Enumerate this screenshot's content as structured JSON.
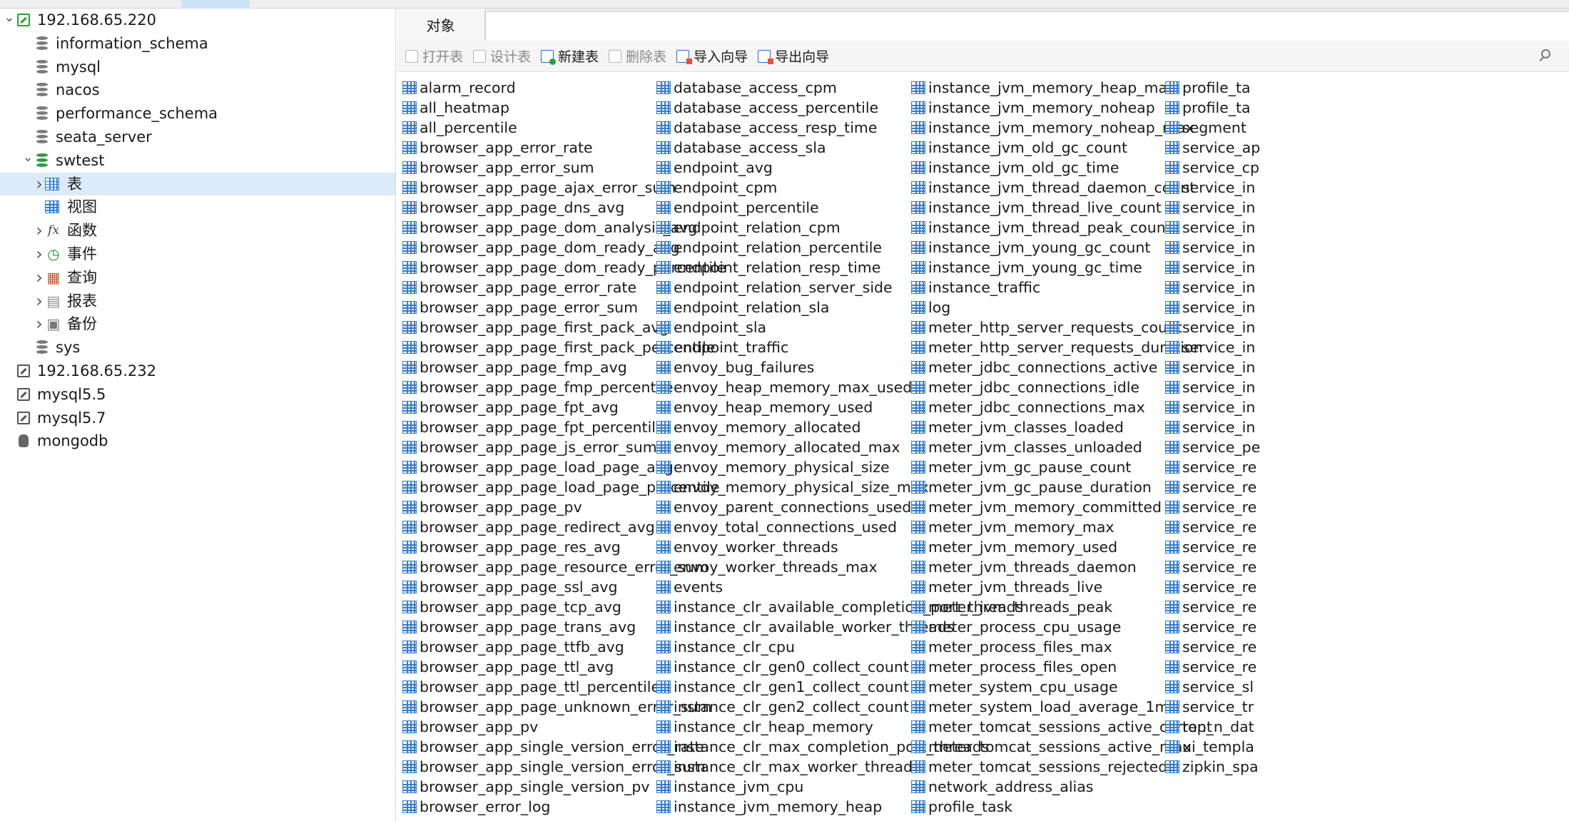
{
  "sidebar": {
    "tree": [
      {
        "label": "192.168.65.220",
        "icon": "connection-green-icon",
        "indent": 0,
        "arrow": "down"
      },
      {
        "label": "information_schema",
        "icon": "database-icon",
        "indent": 1,
        "arrow": ""
      },
      {
        "label": "mysql",
        "icon": "database-icon",
        "indent": 1,
        "arrow": ""
      },
      {
        "label": "nacos",
        "icon": "database-icon",
        "indent": 1,
        "arrow": ""
      },
      {
        "label": "performance_schema",
        "icon": "database-icon",
        "indent": 1,
        "arrow": ""
      },
      {
        "label": "seata_server",
        "icon": "database-icon",
        "indent": 1,
        "arrow": ""
      },
      {
        "label": "swtest",
        "icon": "database-green-icon",
        "indent": 1,
        "arrow": "down"
      },
      {
        "label": "表",
        "icon": "table-icon",
        "indent": 2,
        "arrow": "right",
        "selected": true
      },
      {
        "label": "视图",
        "icon": "view-icon",
        "indent": 2,
        "arrow": ""
      },
      {
        "label": "函数",
        "icon": "function-icon",
        "indent": 2,
        "arrow": "right"
      },
      {
        "label": "事件",
        "icon": "event-icon",
        "indent": 2,
        "arrow": "right"
      },
      {
        "label": "查询",
        "icon": "query-icon",
        "indent": 2,
        "arrow": "right"
      },
      {
        "label": "报表",
        "icon": "report-icon",
        "indent": 2,
        "arrow": "right"
      },
      {
        "label": "备份",
        "icon": "backup-icon",
        "indent": 2,
        "arrow": "right"
      },
      {
        "label": "sys",
        "icon": "database-icon",
        "indent": 1,
        "arrow": ""
      },
      {
        "label": "192.168.65.232",
        "icon": "connection-icon",
        "indent": 0,
        "arrow": ""
      },
      {
        "label": "mysql5.5",
        "icon": "connection-icon",
        "indent": 0,
        "arrow": ""
      },
      {
        "label": "mysql5.7",
        "icon": "connection-icon",
        "indent": 0,
        "arrow": ""
      },
      {
        "label": "mongodb",
        "icon": "mongodb-icon",
        "indent": 0,
        "arrow": ""
      }
    ]
  },
  "tabs": {
    "objects": "对象"
  },
  "toolbar": {
    "open_table": "打开表",
    "design_table": "设计表",
    "new_table": "新建表",
    "delete_table": "删除表",
    "import_wizard": "导入向导",
    "export_wizard": "导出向导"
  },
  "tables": {
    "col1": [
      "alarm_record",
      "all_heatmap",
      "all_percentile",
      "browser_app_error_rate",
      "browser_app_error_sum",
      "browser_app_page_ajax_error_sum",
      "browser_app_page_dns_avg",
      "browser_app_page_dom_analysis_avg",
      "browser_app_page_dom_ready_avg",
      "browser_app_page_dom_ready_percentile",
      "browser_app_page_error_rate",
      "browser_app_page_error_sum",
      "browser_app_page_first_pack_avg",
      "browser_app_page_first_pack_percentile",
      "browser_app_page_fmp_avg",
      "browser_app_page_fmp_percentile",
      "browser_app_page_fpt_avg",
      "browser_app_page_fpt_percentile",
      "browser_app_page_js_error_sum",
      "browser_app_page_load_page_avg",
      "browser_app_page_load_page_percentile",
      "browser_app_page_pv",
      "browser_app_page_redirect_avg",
      "browser_app_page_res_avg",
      "browser_app_page_resource_error_sum",
      "browser_app_page_ssl_avg",
      "browser_app_page_tcp_avg",
      "browser_app_page_trans_avg",
      "browser_app_page_ttfb_avg",
      "browser_app_page_ttl_avg",
      "browser_app_page_ttl_percentile",
      "browser_app_page_unknown_error_sum",
      "browser_app_pv",
      "browser_app_single_version_error_rate",
      "browser_app_single_version_error_sum",
      "browser_app_single_version_pv",
      "browser_error_log"
    ],
    "col2": [
      "database_access_cpm",
      "database_access_percentile",
      "database_access_resp_time",
      "database_access_sla",
      "endpoint_avg",
      "endpoint_cpm",
      "endpoint_percentile",
      "endpoint_relation_cpm",
      "endpoint_relation_percentile",
      "endpoint_relation_resp_time",
      "endpoint_relation_server_side",
      "endpoint_relation_sla",
      "endpoint_sla",
      "endpoint_traffic",
      "envoy_bug_failures",
      "envoy_heap_memory_max_used",
      "envoy_heap_memory_used",
      "envoy_memory_allocated",
      "envoy_memory_allocated_max",
      "envoy_memory_physical_size",
      "envoy_memory_physical_size_max",
      "envoy_parent_connections_used",
      "envoy_total_connections_used",
      "envoy_worker_threads",
      "envoy_worker_threads_max",
      "events",
      "instance_clr_available_completion_port_threads",
      "instance_clr_available_worker_threads",
      "instance_clr_cpu",
      "instance_clr_gen0_collect_count",
      "instance_clr_gen1_collect_count",
      "instance_clr_gen2_collect_count",
      "instance_clr_heap_memory",
      "instance_clr_max_completion_port_threads",
      "instance_clr_max_worker_threads",
      "instance_jvm_cpu",
      "instance_jvm_memory_heap"
    ],
    "col3": [
      "instance_jvm_memory_heap_max",
      "instance_jvm_memory_noheap",
      "instance_jvm_memory_noheap_max",
      "instance_jvm_old_gc_count",
      "instance_jvm_old_gc_time",
      "instance_jvm_thread_daemon_count",
      "instance_jvm_thread_live_count",
      "instance_jvm_thread_peak_count",
      "instance_jvm_young_gc_count",
      "instance_jvm_young_gc_time",
      "instance_traffic",
      "log",
      "meter_http_server_requests_count",
      "meter_http_server_requests_duration",
      "meter_jdbc_connections_active",
      "meter_jdbc_connections_idle",
      "meter_jdbc_connections_max",
      "meter_jvm_classes_loaded",
      "meter_jvm_classes_unloaded",
      "meter_jvm_gc_pause_count",
      "meter_jvm_gc_pause_duration",
      "meter_jvm_memory_committed",
      "meter_jvm_memory_max",
      "meter_jvm_memory_used",
      "meter_jvm_threads_daemon",
      "meter_jvm_threads_live",
      "meter_jvm_threads_peak",
      "meter_process_cpu_usage",
      "meter_process_files_max",
      "meter_process_files_open",
      "meter_system_cpu_usage",
      "meter_system_load_average_1m",
      "meter_tomcat_sessions_active_current",
      "meter_tomcat_sessions_active_max",
      "meter_tomcat_sessions_rejected",
      "network_address_alias",
      "profile_task"
    ],
    "col4": [
      "profile_ta",
      "profile_ta",
      "segment",
      "service_ap",
      "service_cp",
      "service_in",
      "service_in",
      "service_in",
      "service_in",
      "service_in",
      "service_in",
      "service_in",
      "service_in",
      "service_in",
      "service_in",
      "service_in",
      "service_in",
      "service_in",
      "service_pe",
      "service_re",
      "service_re",
      "service_re",
      "service_re",
      "service_re",
      "service_re",
      "service_re",
      "service_re",
      "service_re",
      "service_re",
      "service_re",
      "service_sl",
      "service_tr",
      "top_n_dat",
      "ui_templa",
      "zipkin_spa"
    ]
  }
}
